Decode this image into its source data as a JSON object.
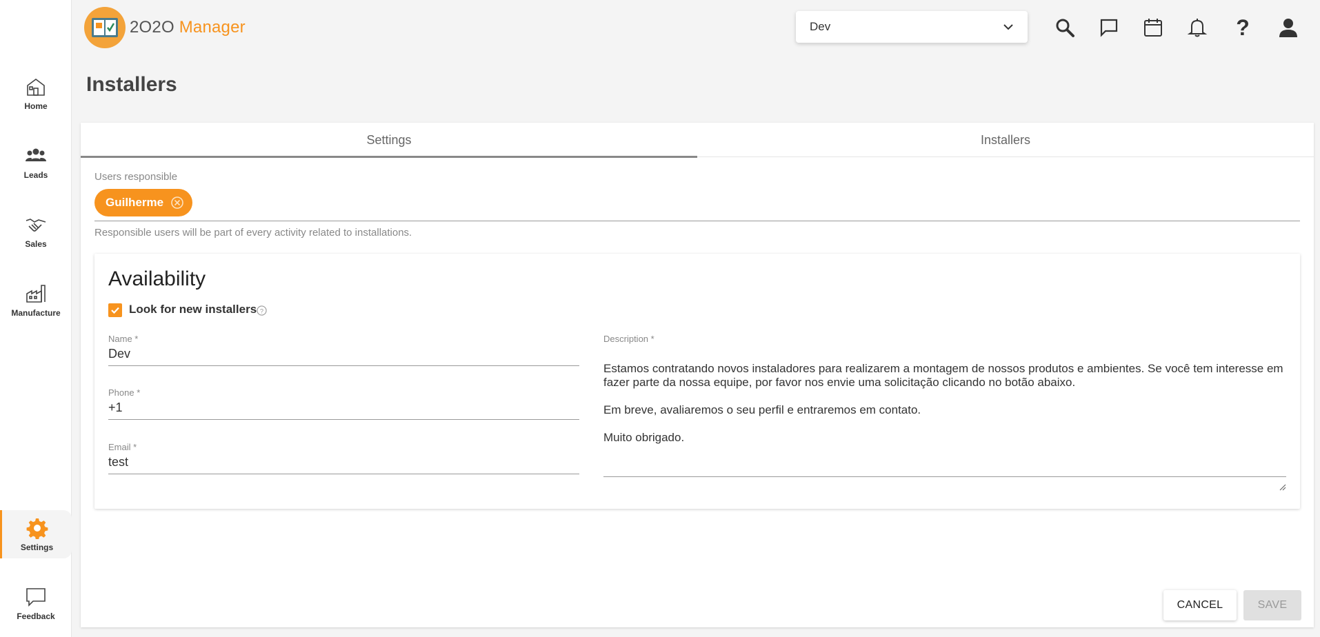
{
  "app": {
    "logo_prefix": "2O2O",
    "logo_suffix": "Manager"
  },
  "environment_select": {
    "value": "Dev"
  },
  "sidebar": {
    "items": [
      {
        "label": "Home",
        "icon": "home-icon"
      },
      {
        "label": "Leads",
        "icon": "users-icon"
      },
      {
        "label": "Sales",
        "icon": "handshake-icon"
      },
      {
        "label": "Manufacture",
        "icon": "factory-icon"
      },
      {
        "label": "Settings",
        "icon": "gear-icon",
        "active": true
      },
      {
        "label": "Feedback",
        "icon": "chat-icon"
      }
    ]
  },
  "header_icons": [
    "search-icon",
    "message-icon",
    "calendar-icon",
    "bell-icon",
    "help-icon",
    "account-icon"
  ],
  "page_title": "Installers",
  "tabs": [
    {
      "label": "Settings",
      "active": true
    },
    {
      "label": "Installers",
      "active": false
    }
  ],
  "users_responsible": {
    "label": "Users responsible",
    "chips": [
      "Guilherme"
    ],
    "hint": "Responsible users will be part of every activity related to installations."
  },
  "availability": {
    "title": "Availability",
    "checkbox_label": "Look for new installers",
    "checked": true,
    "name": {
      "label": "Name *",
      "value": "Dev"
    },
    "phone": {
      "label": "Phone *",
      "value": "+1"
    },
    "email": {
      "label": "Email *",
      "value": "test"
    },
    "description": {
      "label": "Description *",
      "value": "Estamos contratando novos instaladores para realizarem a montagem de nossos produtos e ambientes. Se você tem interesse em fazer parte da nossa equipe, por favor nos envie uma solicitação clicando no botão abaixo.\n\nEm breve, avaliaremos o seu perfil e entraremos em contato.\n\nMuito obrigado."
    }
  },
  "actions": {
    "cancel": "CANCEL",
    "save": "SAVE"
  },
  "colors": {
    "accent": "#f7931e",
    "background": "#f4f4f4"
  }
}
